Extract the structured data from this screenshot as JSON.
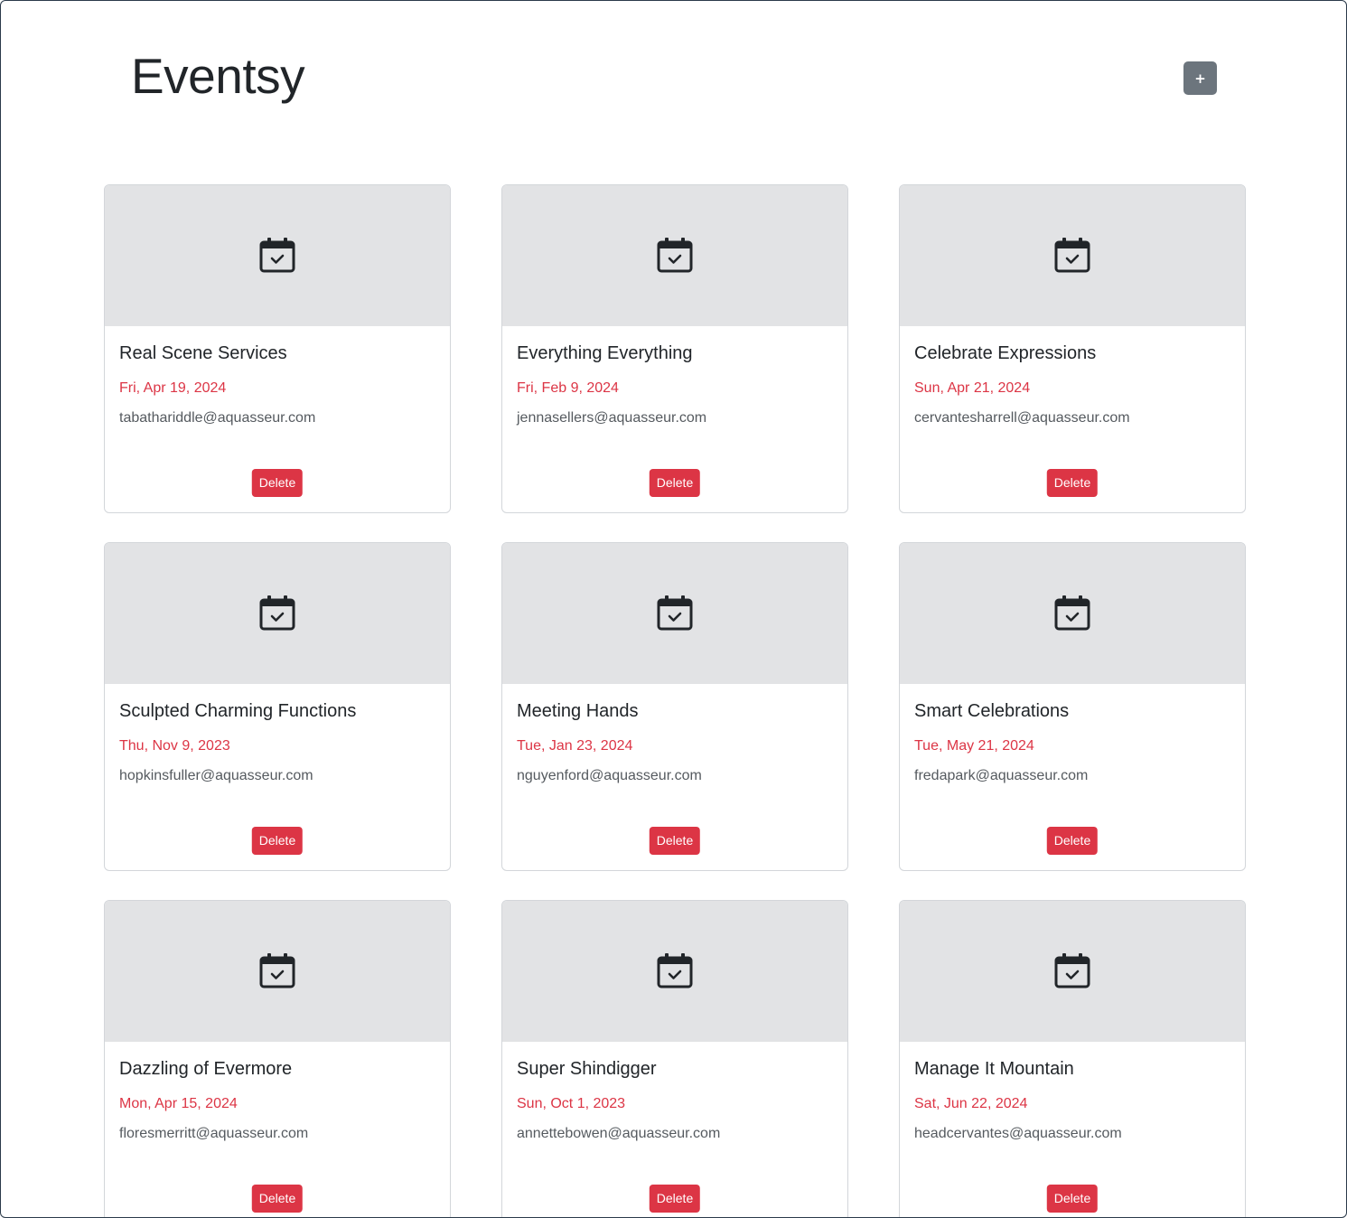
{
  "header": {
    "title": "Eventsy",
    "add_button_label": "+"
  },
  "events": [
    {
      "title": "Real Scene Services",
      "date": "Fri, Apr 19, 2024",
      "email": "tabathariddle@aquasseur.com",
      "delete_label": "Delete"
    },
    {
      "title": "Everything Everything",
      "date": "Fri, Feb 9, 2024",
      "email": "jennasellers@aquasseur.com",
      "delete_label": "Delete"
    },
    {
      "title": "Celebrate Expressions",
      "date": "Sun, Apr 21, 2024",
      "email": "cervantesharrell@aquasseur.com",
      "delete_label": "Delete"
    },
    {
      "title": "Sculpted Charming Functions",
      "date": "Thu, Nov 9, 2023",
      "email": "hopkinsfuller@aquasseur.com",
      "delete_label": "Delete"
    },
    {
      "title": "Meeting Hands",
      "date": "Tue, Jan 23, 2024",
      "email": "nguyenford@aquasseur.com",
      "delete_label": "Delete"
    },
    {
      "title": "Smart Celebrations",
      "date": "Tue, May 21, 2024",
      "email": "fredapark@aquasseur.com",
      "delete_label": "Delete"
    },
    {
      "title": "Dazzling of Evermore",
      "date": "Mon, Apr 15, 2024",
      "email": "floresmerritt@aquasseur.com",
      "delete_label": "Delete"
    },
    {
      "title": "Super Shindigger",
      "date": "Sun, Oct 1, 2023",
      "email": "annettebowen@aquasseur.com",
      "delete_label": "Delete"
    },
    {
      "title": "Manage It Mountain",
      "date": "Sat, Jun 22, 2024",
      "email": "headcervantes@aquasseur.com",
      "delete_label": "Delete"
    }
  ],
  "icons": {
    "card_image": "calendar-check-icon"
  },
  "colors": {
    "date": "#dc3545",
    "delete_button": "#dc3545",
    "add_button": "#6c757d",
    "card_image_bg": "#e2e3e5"
  }
}
